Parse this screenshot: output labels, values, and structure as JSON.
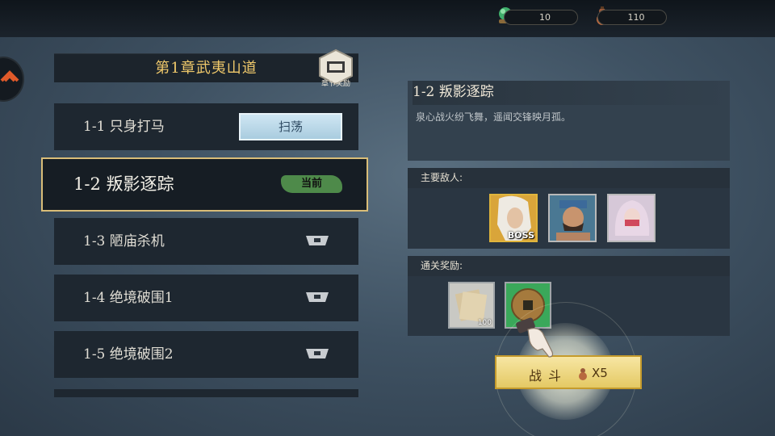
{
  "resources": {
    "jade": {
      "value": "10",
      "icon": "jade-orb-icon"
    },
    "stamina": {
      "value": "110",
      "icon": "gourd-icon"
    }
  },
  "chapter": {
    "title": "第1章武夷山道",
    "reward_label": "章节奖励"
  },
  "stages": [
    {
      "label": "1-1  只身打马",
      "status": "cleared",
      "action": "扫荡"
    },
    {
      "label": "1-2  叛影逐踪",
      "status": "current",
      "action": "当前"
    },
    {
      "label": "1-3  陋庙杀机",
      "status": "locked"
    },
    {
      "label": "1-4  绝境破围1",
      "status": "locked"
    },
    {
      "label": "1-5  绝境破围2",
      "status": "locked"
    }
  ],
  "detail": {
    "title": "1-2  叛影逐踪",
    "description": "泉心战火纷飞舞，遥闻交锋映月孤。",
    "enemies_heading": "主要敌人:",
    "enemies": [
      {
        "name": "white-hair-boss",
        "tag": "BOSS"
      },
      {
        "name": "bandana-bandit"
      },
      {
        "name": "masked-woman"
      }
    ],
    "rewards_heading": "通关奖励:",
    "rewards": [
      {
        "name": "scroll-pages",
        "count": "100"
      },
      {
        "name": "copper-coin"
      }
    ]
  },
  "fight": {
    "label": "战斗",
    "cost": "X5"
  },
  "colors": {
    "accent_gold": "#d9bd78",
    "current_green": "#4e8a4a",
    "sweep_blue": "#a9ccdf"
  }
}
